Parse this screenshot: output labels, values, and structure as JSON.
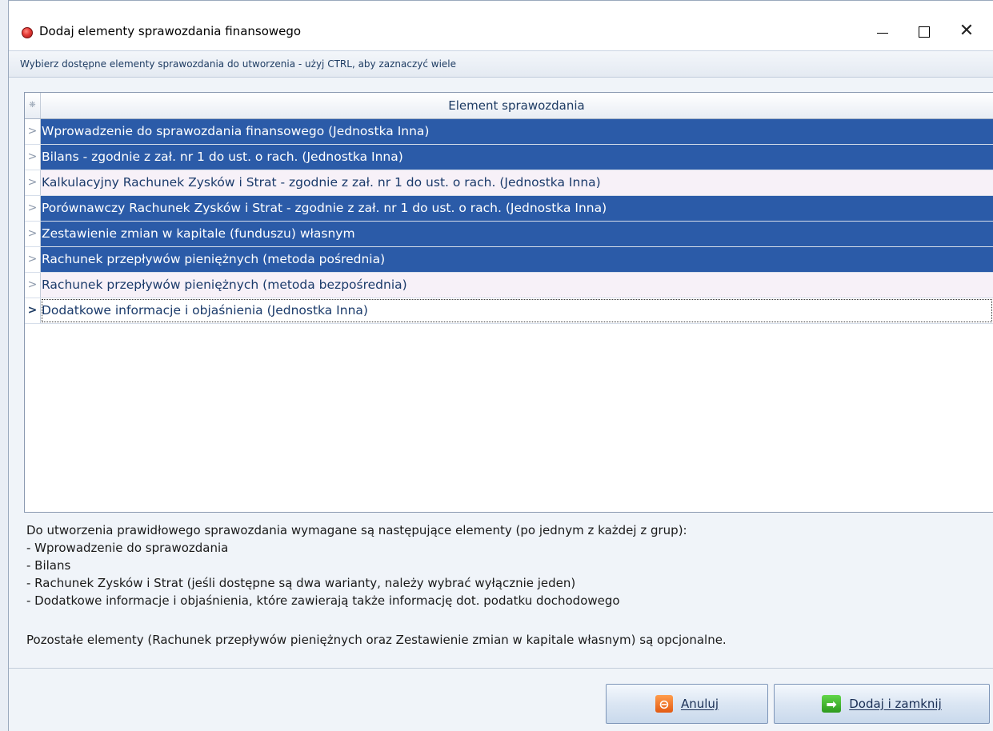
{
  "window": {
    "title": "Dodaj elementy sprawozdania finansowego",
    "close_glyph": "✕"
  },
  "hint": "Wybierz dostępne elementy sprawozdania do utworzenia - użyj CTRL, aby zaznaczyć wiele",
  "grid": {
    "corner_glyph": "❋",
    "column_header": "Element sprawozdania",
    "rows": [
      {
        "label": "Wprowadzenie do sprawozdania finansowego (Jednostka Inna)",
        "state": "selected"
      },
      {
        "label": "Bilans - zgodnie z zał. nr 1 do ust. o rach. (Jednostka Inna)",
        "state": "selected"
      },
      {
        "label": "Kalkulacyjny Rachunek Zysków i Strat - zgodnie z zał. nr 1 do ust. o rach. (Jednostka Inna)",
        "state": "normal"
      },
      {
        "label": "Porównawczy Rachunek Zysków i Strat - zgodnie z zał. nr 1 do ust. o rach. (Jednostka Inna)",
        "state": "selected"
      },
      {
        "label": "Zestawienie zmian w kapitale (funduszu) własnym",
        "state": "selected"
      },
      {
        "label": "Rachunek przepływów pieniężnych (metoda pośrednia)",
        "state": "selected"
      },
      {
        "label": "Rachunek przepływów pieniężnych (metoda bezpośrednia)",
        "state": "normal"
      },
      {
        "label": "Dodatkowe informacje i objaśnienia (Jednostka Inna)",
        "state": "focused"
      }
    ],
    "row_indicator_glyph": ">"
  },
  "requirements": {
    "intro": "Do utworzenia prawidłowego sprawozdania wymagane są następujące elementy (po jednym z każdej z grup):",
    "items": [
      "- Wprowadzenie do sprawozdania",
      "- Bilans",
      "- Rachunek Zysków i Strat (jeśli dostępne są dwa warianty, należy wybrać wyłącznie jeden)",
      "- Dodatkowe informacje i objaśnienia, które zawierają także informację dot. podatku dochodowego"
    ],
    "optional": "Pozostałe elementy (Rachunek przepływów pieniężnych oraz Zestawienie zmian w kapitale własnym) są opcjonalne."
  },
  "buttons": {
    "cancel_label": "Anuluj",
    "add_label": "Dodaj i zamknij"
  },
  "icons": {
    "app": "app-icon",
    "cancel": "cancel-icon",
    "add": "arrow-right-icon"
  }
}
